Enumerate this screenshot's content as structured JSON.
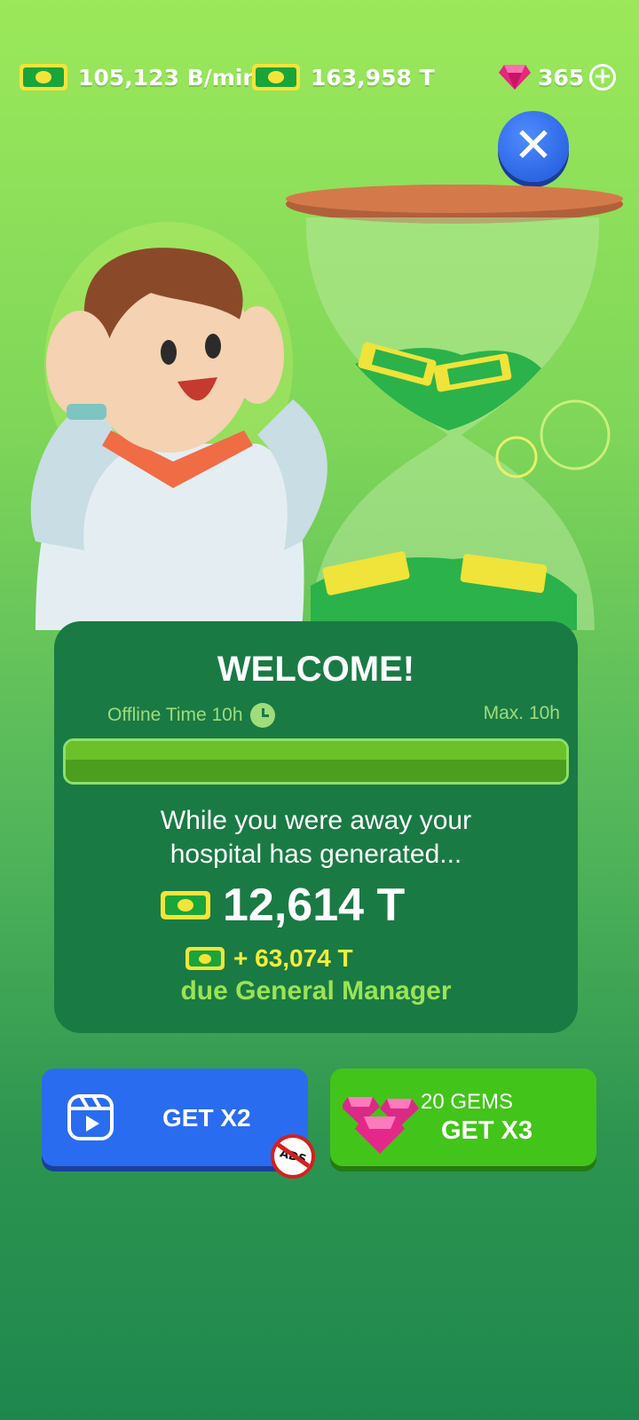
{
  "topbar": {
    "income_rate": "105,123 B/min",
    "cash_total": "163,958 T",
    "gem_count": "365"
  },
  "dialog": {
    "title": "WELCOME!",
    "offline_label": "Offline Time  10h",
    "max_label": "Max.  10h",
    "offline_progress": 1.0,
    "message_line1": "While you were away your",
    "message_line2": "hospital has generated...",
    "earned_amount": "12,614 T",
    "bonus_amount": "+ 63,074 T",
    "bonus_reason": "due General Manager"
  },
  "buttons": {
    "ads_label": "GET X2",
    "ads_badge": "ADS",
    "gems_cost": "20 GEMS",
    "gems_label": "GET X3"
  },
  "colors": {
    "panel": "#1a7a44",
    "blue_button": "#2a6cf0",
    "green_button": "#43c41a",
    "bonus_yellow": "#f2ee3a"
  }
}
